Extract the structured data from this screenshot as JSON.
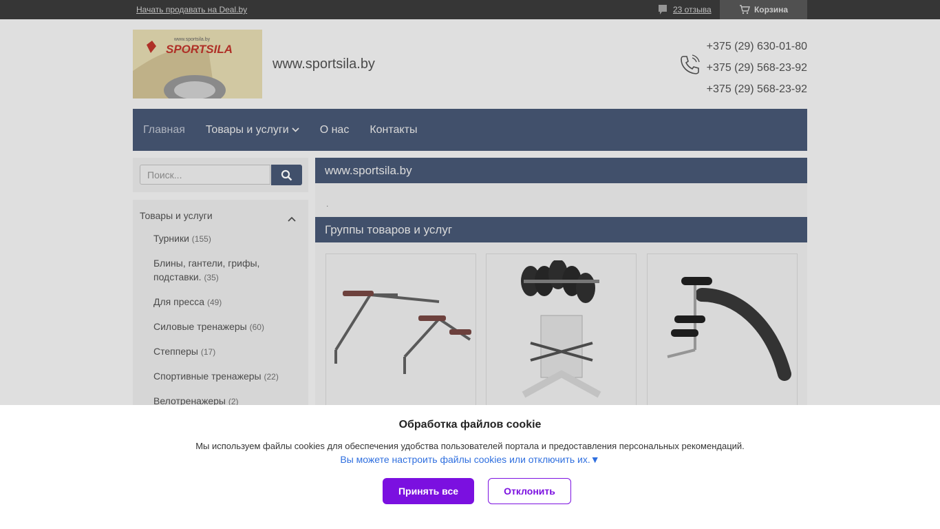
{
  "topbar": {
    "sell_link": "Начать продавать на Deal.by",
    "reviews": "23 отзыва",
    "cart": "Корзина"
  },
  "header": {
    "site_name": "www.sportsila.by",
    "logo_brand": "SPORTSILA",
    "logo_url": "www.sportsila.by",
    "phones": [
      "+375 (29) 630-01-80",
      "+375 (29) 568-23-92",
      "+375 (29) 568-23-92"
    ]
  },
  "nav": {
    "items": [
      "Главная",
      "Товары и услуги",
      "О нас",
      "Контакты"
    ]
  },
  "search": {
    "placeholder": "Поиск..."
  },
  "sidebar": {
    "title": "Товары и услуги",
    "items": [
      {
        "label": "Турники",
        "count": "(155)"
      },
      {
        "label": "Блины, гантели, грифы, подставки.",
        "count": "(35)"
      },
      {
        "label": "Для пресса",
        "count": "(49)"
      },
      {
        "label": "Силовые тренажеры",
        "count": "(60)"
      },
      {
        "label": "Степперы",
        "count": "(17)"
      },
      {
        "label": "Спортивные тренажеры",
        "count": "(22)"
      },
      {
        "label": "Велотренажеры",
        "count": "(2)"
      }
    ]
  },
  "main": {
    "title": "www.sportsila.by",
    "dot": ".",
    "groups_title": "Группы товаров и услуг"
  },
  "cookie": {
    "title": "Обработка файлов cookie",
    "text": "Мы используем файлы cookies для обеспечения удобства пользователей портала и предоставления персональных рекомендаций.",
    "link": "Вы можете настроить файлы cookies или отключить их.▼",
    "accept": "Принять все",
    "decline": "Отклонить"
  },
  "colors": {
    "nav_bg": "#3a4a69",
    "accent_purple": "#7b10e0",
    "link_blue": "#2f6fdf"
  },
  "icons": [
    "comment-icon",
    "cart-icon",
    "phone-icon",
    "search-icon",
    "chevron-down-icon",
    "chevron-up-icon"
  ]
}
